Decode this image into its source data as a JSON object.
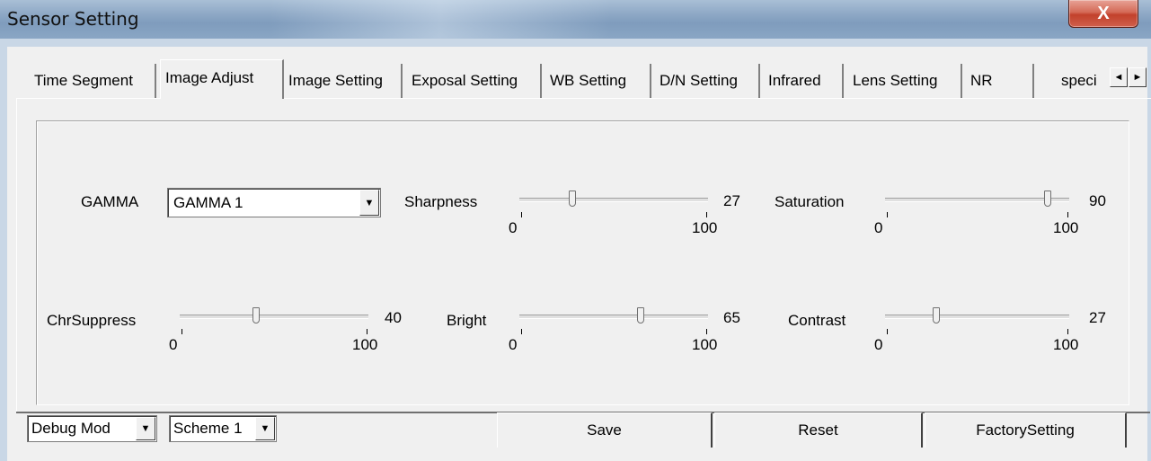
{
  "window": {
    "title": "Sensor Setting",
    "close_label": "X"
  },
  "tabs": [
    {
      "label": "Time Segment"
    },
    {
      "label": "Image Adjust"
    },
    {
      "label": "Image Setting"
    },
    {
      "label": "Exposal Setting"
    },
    {
      "label": "WB Setting"
    },
    {
      "label": "D/N Setting"
    },
    {
      "label": "Infrared"
    },
    {
      "label": "Lens Setting"
    },
    {
      "label": "NR"
    },
    {
      "label": "speci"
    }
  ],
  "tab_scroll": {
    "left_icon": "left-arrow-icon",
    "right_icon": "right-arrow-icon",
    "left_glyph": "◄",
    "right_glyph": "►"
  },
  "gamma": {
    "label": "GAMMA",
    "value": "GAMMA 1"
  },
  "sliders": {
    "sharpness": {
      "label": "Sharpness",
      "value": "27",
      "min": "0",
      "max": "100",
      "level": 0.27
    },
    "saturation": {
      "label": "Saturation",
      "value": "90",
      "min": "0",
      "max": "100",
      "level": 0.9
    },
    "chrsuppress": {
      "label": "ChrSuppress",
      "value": "40",
      "min": "0",
      "max": "100",
      "level": 0.4
    },
    "bright": {
      "label": "Bright",
      "value": "65",
      "min": "0",
      "max": "100",
      "level": 0.65
    },
    "contrast": {
      "label": "Contrast",
      "value": "27",
      "min": "0",
      "max": "100",
      "level": 0.27
    }
  },
  "bottom": {
    "mode_value": "Debug Mod",
    "scheme_value": "Scheme 1",
    "save_label": "Save",
    "reset_label": "Reset",
    "factory_label": "FactorySetting"
  },
  "dropdown_glyph": "▼"
}
